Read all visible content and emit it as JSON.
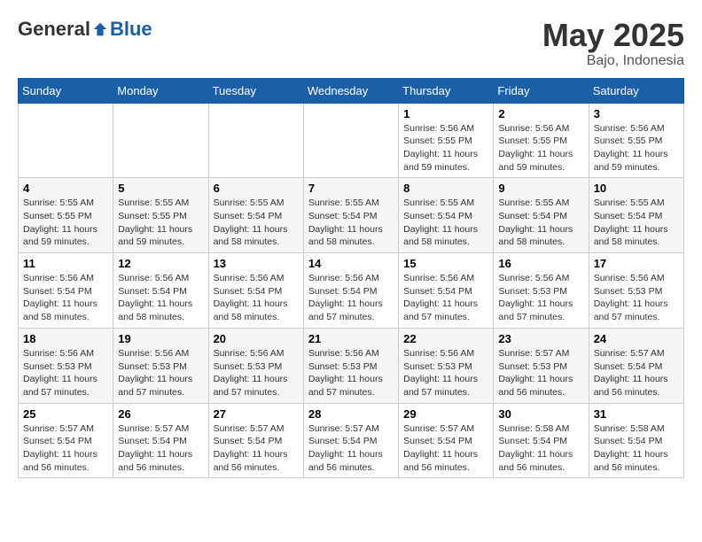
{
  "logo": {
    "general": "General",
    "blue": "Blue"
  },
  "title": {
    "month_year": "May 2025",
    "location": "Bajo, Indonesia"
  },
  "weekdays": [
    "Sunday",
    "Monday",
    "Tuesday",
    "Wednesday",
    "Thursday",
    "Friday",
    "Saturday"
  ],
  "weeks": [
    {
      "days": [
        {
          "num": "",
          "detail": ""
        },
        {
          "num": "",
          "detail": ""
        },
        {
          "num": "",
          "detail": ""
        },
        {
          "num": "",
          "detail": ""
        },
        {
          "num": "1",
          "detail": "Sunrise: 5:56 AM\nSunset: 5:55 PM\nDaylight: 11 hours\nand 59 minutes."
        },
        {
          "num": "2",
          "detail": "Sunrise: 5:56 AM\nSunset: 5:55 PM\nDaylight: 11 hours\nand 59 minutes."
        },
        {
          "num": "3",
          "detail": "Sunrise: 5:56 AM\nSunset: 5:55 PM\nDaylight: 11 hours\nand 59 minutes."
        }
      ]
    },
    {
      "days": [
        {
          "num": "4",
          "detail": "Sunrise: 5:55 AM\nSunset: 5:55 PM\nDaylight: 11 hours\nand 59 minutes."
        },
        {
          "num": "5",
          "detail": "Sunrise: 5:55 AM\nSunset: 5:55 PM\nDaylight: 11 hours\nand 59 minutes."
        },
        {
          "num": "6",
          "detail": "Sunrise: 5:55 AM\nSunset: 5:54 PM\nDaylight: 11 hours\nand 58 minutes."
        },
        {
          "num": "7",
          "detail": "Sunrise: 5:55 AM\nSunset: 5:54 PM\nDaylight: 11 hours\nand 58 minutes."
        },
        {
          "num": "8",
          "detail": "Sunrise: 5:55 AM\nSunset: 5:54 PM\nDaylight: 11 hours\nand 58 minutes."
        },
        {
          "num": "9",
          "detail": "Sunrise: 5:55 AM\nSunset: 5:54 PM\nDaylight: 11 hours\nand 58 minutes."
        },
        {
          "num": "10",
          "detail": "Sunrise: 5:55 AM\nSunset: 5:54 PM\nDaylight: 11 hours\nand 58 minutes."
        }
      ]
    },
    {
      "days": [
        {
          "num": "11",
          "detail": "Sunrise: 5:56 AM\nSunset: 5:54 PM\nDaylight: 11 hours\nand 58 minutes."
        },
        {
          "num": "12",
          "detail": "Sunrise: 5:56 AM\nSunset: 5:54 PM\nDaylight: 11 hours\nand 58 minutes."
        },
        {
          "num": "13",
          "detail": "Sunrise: 5:56 AM\nSunset: 5:54 PM\nDaylight: 11 hours\nand 58 minutes."
        },
        {
          "num": "14",
          "detail": "Sunrise: 5:56 AM\nSunset: 5:54 PM\nDaylight: 11 hours\nand 57 minutes."
        },
        {
          "num": "15",
          "detail": "Sunrise: 5:56 AM\nSunset: 5:54 PM\nDaylight: 11 hours\nand 57 minutes."
        },
        {
          "num": "16",
          "detail": "Sunrise: 5:56 AM\nSunset: 5:53 PM\nDaylight: 11 hours\nand 57 minutes."
        },
        {
          "num": "17",
          "detail": "Sunrise: 5:56 AM\nSunset: 5:53 PM\nDaylight: 11 hours\nand 57 minutes."
        }
      ]
    },
    {
      "days": [
        {
          "num": "18",
          "detail": "Sunrise: 5:56 AM\nSunset: 5:53 PM\nDaylight: 11 hours\nand 57 minutes."
        },
        {
          "num": "19",
          "detail": "Sunrise: 5:56 AM\nSunset: 5:53 PM\nDaylight: 11 hours\nand 57 minutes."
        },
        {
          "num": "20",
          "detail": "Sunrise: 5:56 AM\nSunset: 5:53 PM\nDaylight: 11 hours\nand 57 minutes."
        },
        {
          "num": "21",
          "detail": "Sunrise: 5:56 AM\nSunset: 5:53 PM\nDaylight: 11 hours\nand 57 minutes."
        },
        {
          "num": "22",
          "detail": "Sunrise: 5:56 AM\nSunset: 5:53 PM\nDaylight: 11 hours\nand 57 minutes."
        },
        {
          "num": "23",
          "detail": "Sunrise: 5:57 AM\nSunset: 5:53 PM\nDaylight: 11 hours\nand 56 minutes."
        },
        {
          "num": "24",
          "detail": "Sunrise: 5:57 AM\nSunset: 5:54 PM\nDaylight: 11 hours\nand 56 minutes."
        }
      ]
    },
    {
      "days": [
        {
          "num": "25",
          "detail": "Sunrise: 5:57 AM\nSunset: 5:54 PM\nDaylight: 11 hours\nand 56 minutes."
        },
        {
          "num": "26",
          "detail": "Sunrise: 5:57 AM\nSunset: 5:54 PM\nDaylight: 11 hours\nand 56 minutes."
        },
        {
          "num": "27",
          "detail": "Sunrise: 5:57 AM\nSunset: 5:54 PM\nDaylight: 11 hours\nand 56 minutes."
        },
        {
          "num": "28",
          "detail": "Sunrise: 5:57 AM\nSunset: 5:54 PM\nDaylight: 11 hours\nand 56 minutes."
        },
        {
          "num": "29",
          "detail": "Sunrise: 5:57 AM\nSunset: 5:54 PM\nDaylight: 11 hours\nand 56 minutes."
        },
        {
          "num": "30",
          "detail": "Sunrise: 5:58 AM\nSunset: 5:54 PM\nDaylight: 11 hours\nand 56 minutes."
        },
        {
          "num": "31",
          "detail": "Sunrise: 5:58 AM\nSunset: 5:54 PM\nDaylight: 11 hours\nand 56 minutes."
        }
      ]
    }
  ]
}
